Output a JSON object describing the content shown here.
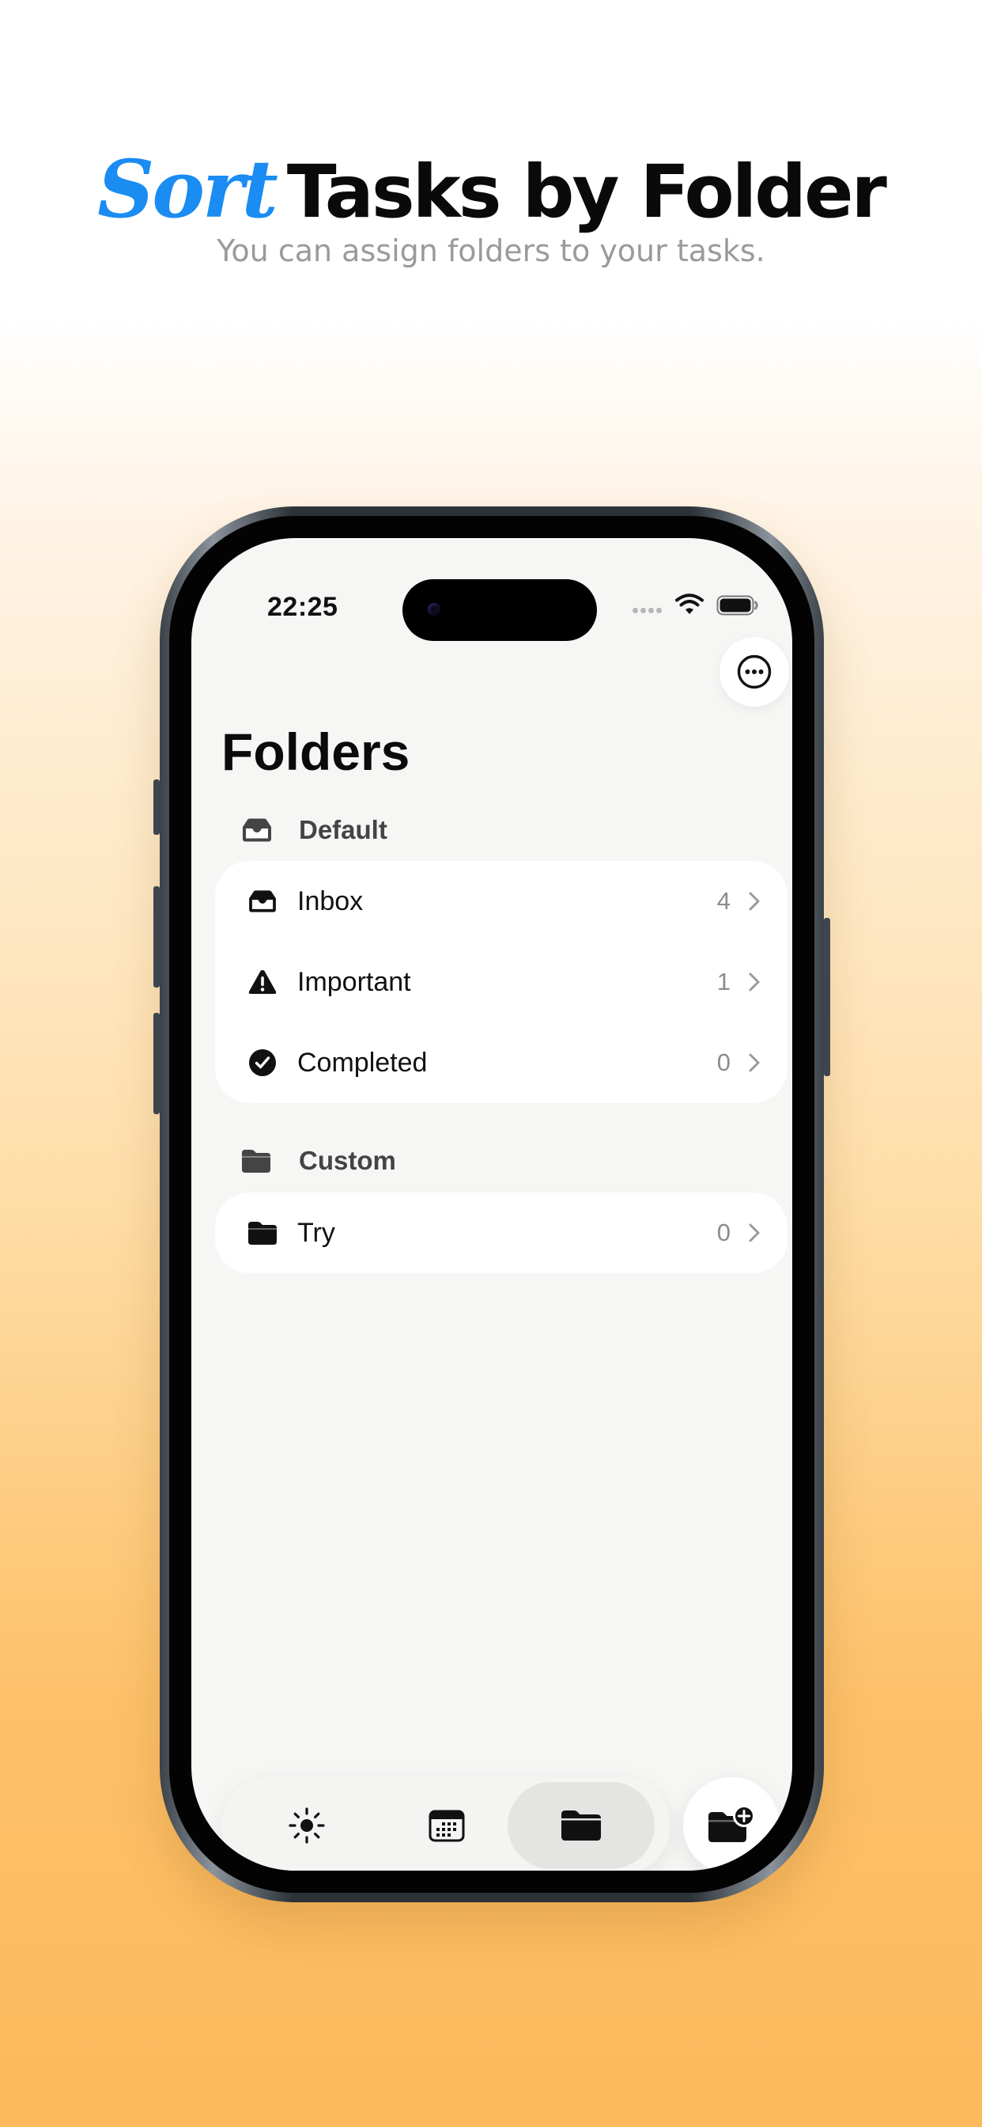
{
  "headline": {
    "accent": "Sort",
    "rest": "Tasks by Folder",
    "subtitle": "You can assign folders to your tasks.",
    "accent_color": "#1a8cf2"
  },
  "status_bar": {
    "time": "22:25"
  },
  "page": {
    "title": "Folders"
  },
  "sections": {
    "default": {
      "label": "Default",
      "icon": "tray-icon",
      "items": [
        {
          "label": "Inbox",
          "count": "4",
          "icon": "tray-icon"
        },
        {
          "label": "Important",
          "count": "1",
          "icon": "warning-triangle-icon"
        },
        {
          "label": "Completed",
          "count": "0",
          "icon": "checkmark-circle-icon"
        }
      ]
    },
    "custom": {
      "label": "Custom",
      "icon": "folder-icon",
      "items": [
        {
          "label": "Try",
          "count": "0",
          "icon": "folder-icon"
        }
      ]
    }
  },
  "tabbar": {
    "tabs": [
      {
        "icon": "sun-icon",
        "active": false
      },
      {
        "icon": "calendar-icon",
        "active": false
      },
      {
        "icon": "folder-icon",
        "active": true
      }
    ],
    "fab_icon": "folder-add-icon"
  },
  "colors": {
    "background_top": "#ffffff",
    "background_bottom": "#fdb95b",
    "screen_bg": "#f6f6f5",
    "card_bg": "#ffffff"
  }
}
